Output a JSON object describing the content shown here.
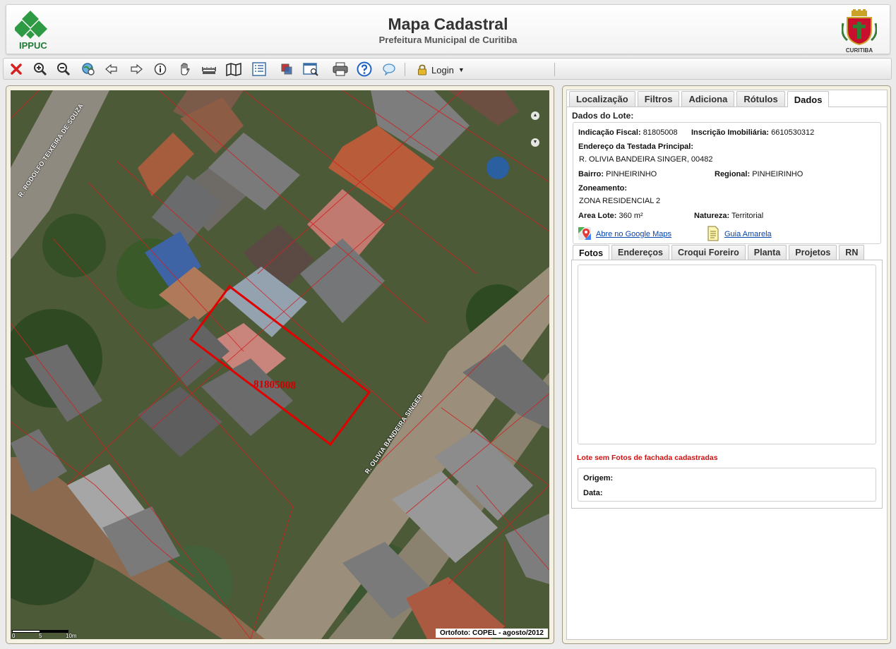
{
  "header": {
    "title": "Mapa Cadastral",
    "subtitle": "Prefeitura Municipal de Curitiba",
    "left_logo_text": "IPPUC",
    "right_logo_text": "CURITIBA"
  },
  "toolbar": {
    "icons": [
      "close-icon",
      "zoom-in-icon",
      "zoom-out-icon",
      "zoom-extent-icon",
      "back-arrow-icon",
      "forward-arrow-icon",
      "info-icon",
      "pan-hand-icon",
      "measure-icon",
      "map-icon",
      "layers-list-icon",
      "overlay-icon",
      "search-window-icon",
      "print-icon",
      "help-icon",
      "comment-icon"
    ],
    "login_label": "Login"
  },
  "map": {
    "lot_label": "81805008",
    "street_1": "R. RODOLFO TEIXEIRA DE SOUZA",
    "street_2": "R. OLIVIA BANDEIRA SINGER",
    "credit": "Ortofoto: COPEL - agosto/2012",
    "scale_labels": [
      "0",
      "5",
      "10m"
    ]
  },
  "panel": {
    "tabs_top": [
      "Localização",
      "Filtros",
      "Adiciona",
      "Rótulos",
      "Dados"
    ],
    "active_top_tab": "Dados",
    "lote_heading": "Dados do Lote:",
    "fields": {
      "indicacao_label": "Indicação Fiscal:",
      "indicacao_value": "81805008",
      "inscricao_label": "Inscrição Imobiliária:",
      "inscricao_value": "6610530312",
      "endereco_label": "Endereço da Testada Principal:",
      "endereco_value": "R. OLIVIA BANDEIRA SINGER, 00482",
      "bairro_label": "Bairro:",
      "bairro_value": "PINHEIRINHO",
      "regional_label": "Regional:",
      "regional_value": "PINHEIRINHO",
      "zoneamento_label": "Zoneamento:",
      "zoneamento_value": "ZONA RESIDENCIAL 2",
      "area_label": "Area Lote:",
      "area_value": "360 m²",
      "natureza_label": "Natureza:",
      "natureza_value": "Territorial"
    },
    "links": {
      "google_maps": "Abre no Google Maps",
      "guia_amarela": "Guia Amarela"
    },
    "tabs_bottom": [
      "Fotos",
      "Endereços",
      "Croqui Foreiro",
      "Planta",
      "Projetos",
      "RN"
    ],
    "active_bottom_tab": "Fotos",
    "no_photos_msg": "Lote sem Fotos de fachada cadastradas",
    "origem_label": "Origem:",
    "data_label": "Data:"
  },
  "colors": {
    "lot_outline": "#e00000",
    "no_photos_text": "#d11010",
    "link": "#0645ad"
  }
}
